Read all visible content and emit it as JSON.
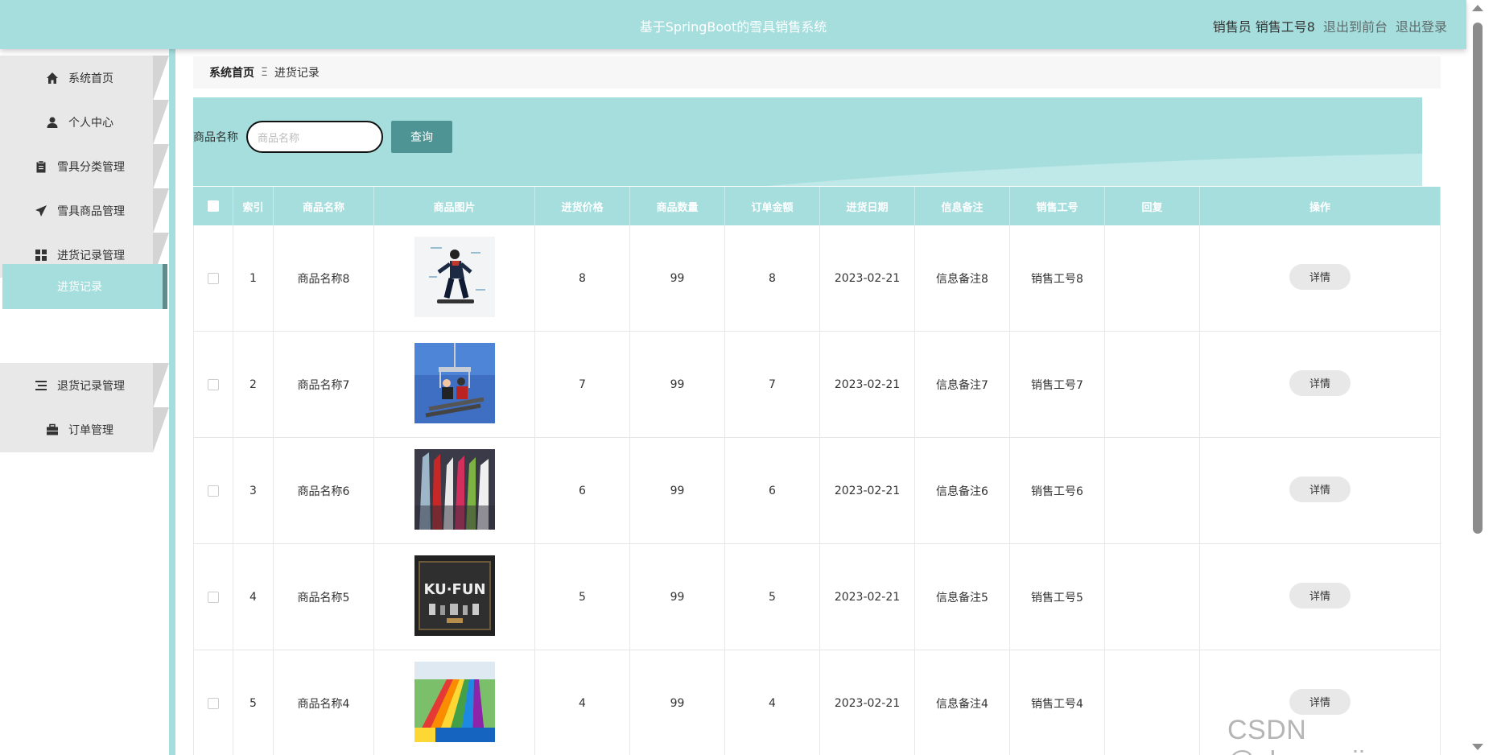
{
  "header": {
    "title": "基于SpringBoot的雪具销售系统",
    "role": "销售员 销售工号8",
    "front_link": "退出到前台",
    "logout_link": "退出登录"
  },
  "sidebar": {
    "items": [
      {
        "label": "系统首页",
        "icon": "home-icon"
      },
      {
        "label": "个人中心",
        "icon": "user-icon"
      },
      {
        "label": "雪具分类管理",
        "icon": "clipboard-icon"
      },
      {
        "label": "雪具商品管理",
        "icon": "send-icon"
      },
      {
        "label": "进货记录管理",
        "icon": "grid-icon"
      },
      {
        "label": "退货记录管理",
        "icon": "list-icon"
      },
      {
        "label": "订单管理",
        "icon": "briefcase-icon"
      }
    ],
    "active_sub": "进货记录"
  },
  "breadcrumb": {
    "home": "系统首页",
    "sep": "Ξ",
    "current": "进货记录"
  },
  "search": {
    "label": "商品名称",
    "placeholder": "商品名称",
    "button": "查询"
  },
  "table": {
    "headers": [
      "",
      "索引",
      "商品名称",
      "商品图片",
      "进货价格",
      "商品数量",
      "订单金额",
      "进货日期",
      "信息备注",
      "销售工号",
      "回复",
      "操作"
    ],
    "rows": [
      {
        "index": "1",
        "name": "商品名称8",
        "price": "8",
        "qty": "99",
        "amount": "8",
        "date": "2023-02-21",
        "note": "信息备注8",
        "staff": "销售工号8",
        "reply": "",
        "action": "详情",
        "img": "snowboarder"
      },
      {
        "index": "2",
        "name": "商品名称7",
        "price": "7",
        "qty": "99",
        "amount": "7",
        "date": "2023-02-21",
        "note": "信息备注7",
        "staff": "销售工号7",
        "reply": "",
        "action": "详情",
        "img": "chairlift"
      },
      {
        "index": "3",
        "name": "商品名称6",
        "price": "6",
        "qty": "99",
        "amount": "6",
        "date": "2023-02-21",
        "note": "信息备注6",
        "staff": "销售工号6",
        "reply": "",
        "action": "详情",
        "img": "skis"
      },
      {
        "index": "4",
        "name": "商品名称5",
        "price": "5",
        "qty": "99",
        "amount": "5",
        "date": "2023-02-21",
        "note": "信息备注5",
        "staff": "销售工号5",
        "reply": "",
        "action": "详情",
        "img": "shop-sign"
      },
      {
        "index": "5",
        "name": "商品名称4",
        "price": "4",
        "qty": "99",
        "amount": "4",
        "date": "2023-02-21",
        "note": "信息备注4",
        "staff": "销售工号4",
        "reply": "",
        "action": "详情",
        "img": "rainbow-slide"
      }
    ]
  },
  "watermark": "CSDN @shaoweijava",
  "colors": {
    "accent": "#a6dede",
    "button": "#4f9494",
    "sidebar_active_border": "#5e8c8c"
  }
}
